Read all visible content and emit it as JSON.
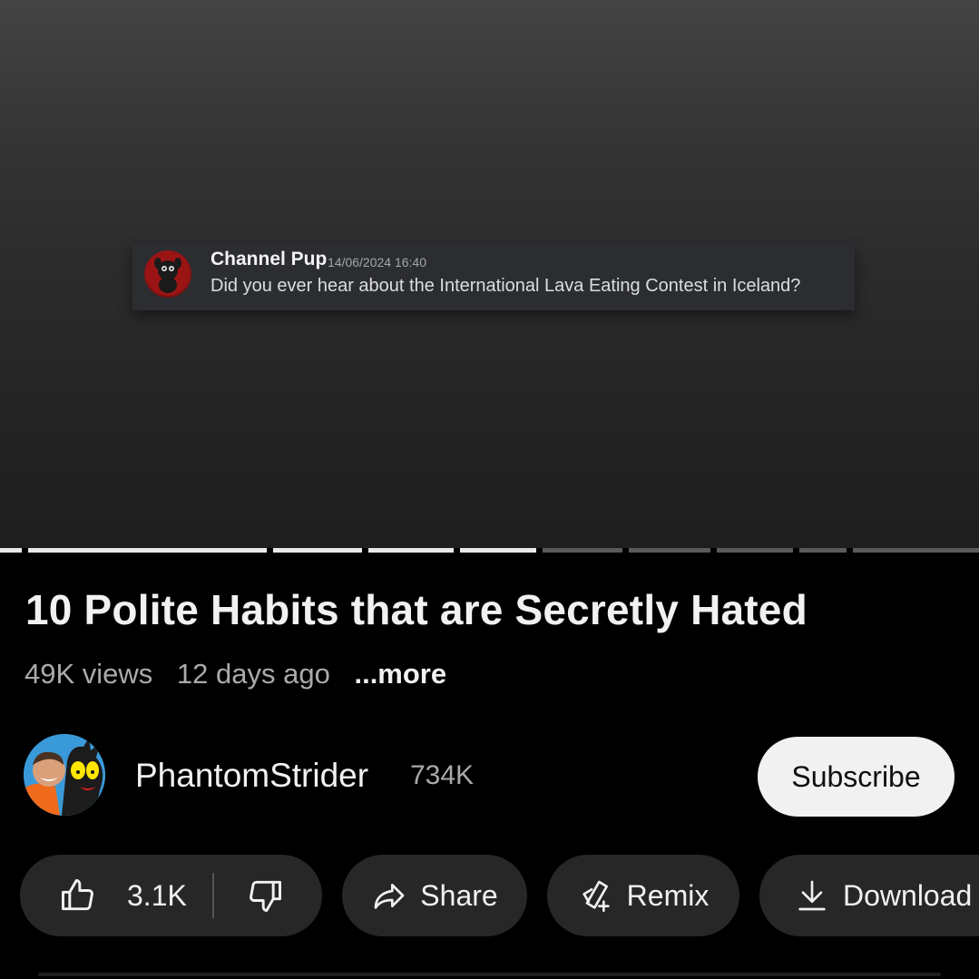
{
  "video": {
    "message": {
      "author": "Channel Pup",
      "timestamp": "14/06/2024 16:40",
      "text": "Did you ever hear about the International Lava Eating Contest in Iceland?"
    },
    "progress_played_fraction": 0.55
  },
  "details": {
    "title": "10 Polite Habits that are Secretly Hated",
    "views": "49K views",
    "age": "12 days ago",
    "more_label": "...more"
  },
  "channel": {
    "name": "PhantomStrider",
    "subscribers": "734K",
    "subscribe_label": "Subscribe"
  },
  "actions": {
    "like_count": "3.1K",
    "share_label": "Share",
    "remix_label": "Remix",
    "download_label": "Download"
  },
  "icons": [
    "like-icon",
    "dislike-icon",
    "share-icon",
    "remix-icon",
    "download-icon"
  ]
}
